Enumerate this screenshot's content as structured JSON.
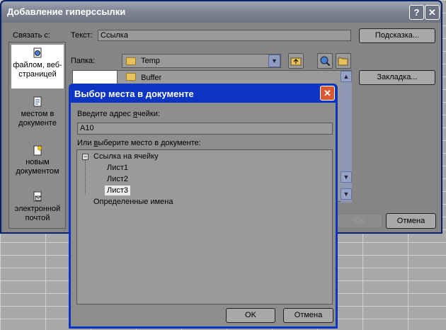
{
  "main_dialog": {
    "title": "Добавление гиперссылки",
    "help_button": "?",
    "close_button": "✕",
    "link_to_label": "Связать с:",
    "link_types": [
      {
        "label": "файлом, веб-страницей",
        "icon": "globe-page-icon"
      },
      {
        "label": "местом в документе",
        "icon": "document-place-icon"
      },
      {
        "label": "новым документом",
        "icon": "new-document-icon"
      },
      {
        "label": "электронной почтой",
        "icon": "email-icon"
      }
    ],
    "text_label": "Текст:",
    "text_value": "Ссылка",
    "tooltip_button": "Подсказка...",
    "folder_label": "Папка:",
    "folder_value": "Temp",
    "file_list_items": [
      "Buffer"
    ],
    "bookmark_button": "Закладка...",
    "ok_button": "OK",
    "cancel_button": "Отмена"
  },
  "place_dialog": {
    "title": "Выбор места в документе",
    "close_button": "✕",
    "cell_address_label_pre": "Введите адрес ",
    "cell_address_label_u": "я",
    "cell_address_label_post": "чейки:",
    "cell_address_value": "A10",
    "place_label_pre": "Или ",
    "place_label_u": "в",
    "place_label_post": "ыберите место в документе:",
    "tree": {
      "root_toggle": "−",
      "root": "Ссылка на ячейку",
      "sheets": [
        "Лист1",
        "Лист2",
        "Лист3"
      ],
      "selected_sheet": "Лист3",
      "defined_names": "Определенные имена"
    },
    "ok_button": "OK",
    "cancel_button": "Отмена"
  }
}
